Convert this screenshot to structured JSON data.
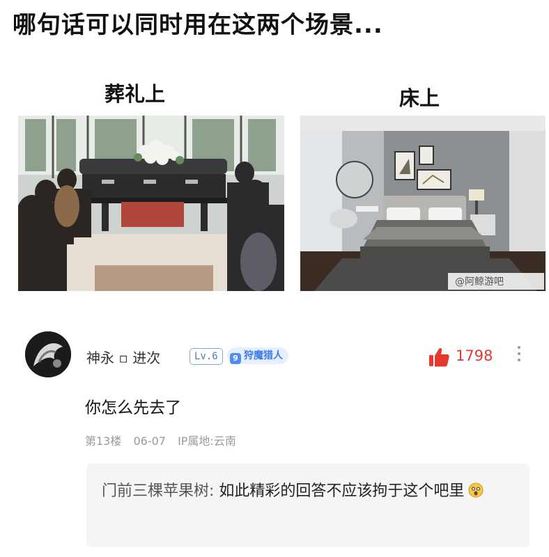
{
  "post": {
    "title": "哪句话可以同时用在这两个场景..."
  },
  "images": {
    "left": {
      "caption": "葬礼上"
    },
    "right": {
      "caption": "床上",
      "watermark": "@阿鲸游吧"
    }
  },
  "comment": {
    "avatar_icon": "avatar-image",
    "username": "神永 ▫ 进次",
    "level": "Lv.6",
    "badge_num": "9",
    "badge_label": "狩魔猎人",
    "like_icon": "thumbs-up-icon",
    "like_count": "1798",
    "like_color": "#e5392f",
    "text": "你怎么先去了",
    "floor": "第13楼",
    "date": "06-07",
    "ip": "IP属地:云南"
  },
  "reply": {
    "author": "门前三棵苹果树:",
    "text": " 如此精彩的回答不应该拘于这个吧里",
    "emoji_icon": "surprised-face-icon"
  }
}
